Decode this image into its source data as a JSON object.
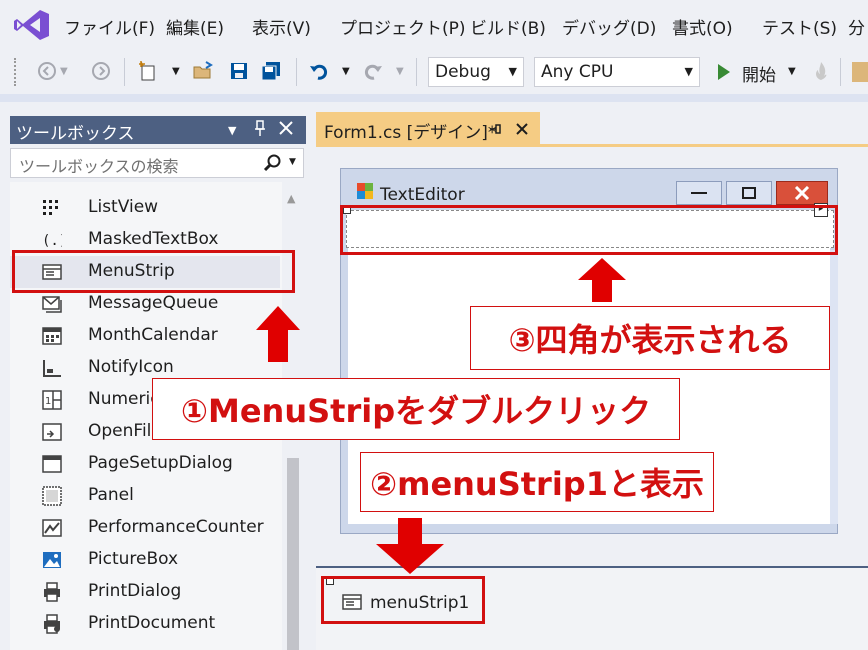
{
  "menubar": {
    "items": [
      "ファイル(F)",
      "編集(E)",
      "表示(V)",
      "プロジェクト(P)",
      "ビルド(B)",
      "デバッグ(D)",
      "書式(O)",
      "テスト(S)",
      "分"
    ]
  },
  "toolbar": {
    "config": "Debug",
    "platform": "Any CPU",
    "start_label": "開始"
  },
  "toolbox": {
    "title": "ツールボックス",
    "search_placeholder": "ツールボックスの検索",
    "items": [
      {
        "label": "ListView",
        "icon": "listview-icon"
      },
      {
        "label": "MaskedTextBox",
        "icon": "maskedtextbox-icon"
      },
      {
        "label": "MenuStrip",
        "icon": "menustrip-icon"
      },
      {
        "label": "MessageQueue",
        "icon": "messagequeue-icon"
      },
      {
        "label": "MonthCalendar",
        "icon": "monthcalendar-icon"
      },
      {
        "label": "NotifyIcon",
        "icon": "notifyicon-icon"
      },
      {
        "label": "Numeric",
        "icon": "numericupdown-icon"
      },
      {
        "label": "OpenFile",
        "icon": "openfiledialog-icon"
      },
      {
        "label": "PageSetupDialog",
        "icon": "pagesetupdialog-icon"
      },
      {
        "label": "Panel",
        "icon": "panel-icon"
      },
      {
        "label": "PerformanceCounter",
        "icon": "performancecounter-icon"
      },
      {
        "label": "PictureBox",
        "icon": "picturebox-icon"
      },
      {
        "label": "PrintDialog",
        "icon": "printdialog-icon"
      },
      {
        "label": "PrintDocument",
        "icon": "printdocument-icon"
      }
    ]
  },
  "designer": {
    "tab_label": "Form1.cs [デザイン]*",
    "form_title": "TextEditor",
    "tray_component": "menuStrip1"
  },
  "annotations": {
    "step1": "①MenuStripをダブルクリック",
    "step2": "②menuStrip1と表示",
    "step3": "③四角が表示される"
  },
  "colors": {
    "accent_red": "#d21010",
    "panel_header": "#4d6082",
    "tab_active": "#f5cc84",
    "vs_purple": "#7a4fd2"
  }
}
